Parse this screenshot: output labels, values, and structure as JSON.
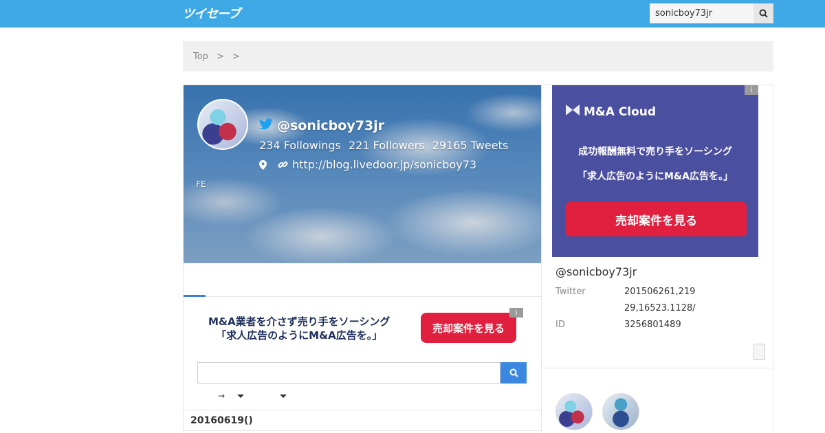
{
  "header": {
    "logo_text": "ツイセーブ",
    "search_value": "sonicboy73jr"
  },
  "breadcrumb": {
    "items": [
      "Top",
      ">",
      ">"
    ]
  },
  "profile": {
    "handle": "@sonicboy73jr",
    "followings": "234 Followings",
    "followers": "221 Followers",
    "tweets": "29165 Tweets",
    "url": "http://blog.livedoor.jp/sonicboy73",
    "bio": "FE"
  },
  "ad_inline": {
    "line1": "M&A業者を介さず売り手をソーシング",
    "line2": "「求人広告のようにM&A広告を。」",
    "cta": "売却案件を見る",
    "info": "i"
  },
  "filters": {
    "arrow": "→"
  },
  "timeline": {
    "date": "20160619()"
  },
  "ad_side": {
    "brand": "M&A Cloud",
    "line1": "成功報酬無料で売り手をソーシング",
    "line2": "「求人広告のようにM&A広告を。」",
    "cta": "売却案件を見る",
    "info": "i"
  },
  "side": {
    "handle": "@sonicboy73jr",
    "rows": [
      {
        "k": "Twitter",
        "v": "201506261,219"
      },
      {
        "k": "",
        "v": "29,16523.1128/"
      },
      {
        "k": "ID",
        "v": "3256801489"
      }
    ]
  },
  "colors": {
    "header": "#3fa9e6",
    "accent": "#3b88e0",
    "cta": "#e0203e",
    "ad_side_bg": "#4b4fa0"
  }
}
